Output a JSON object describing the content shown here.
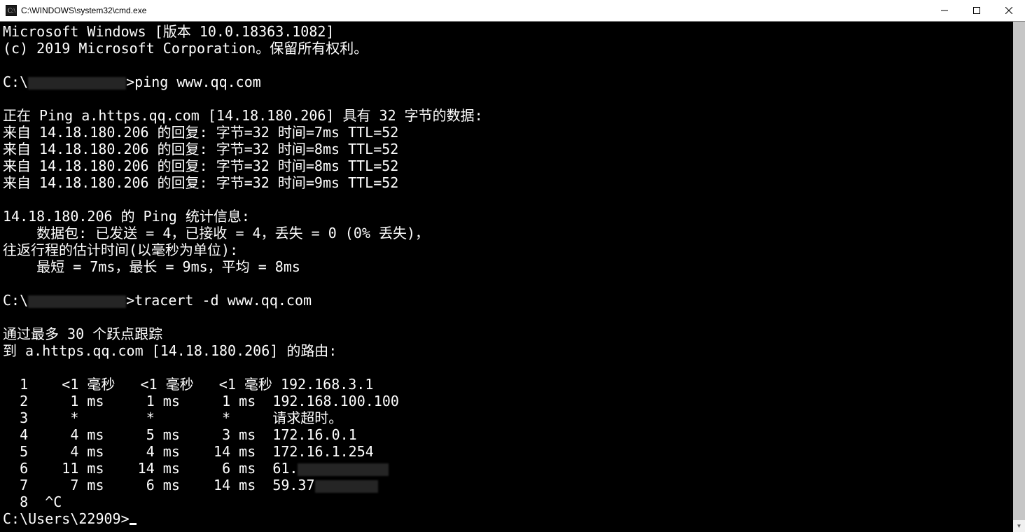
{
  "titlebar": {
    "path": "C:\\WINDOWS\\system32\\cmd.exe"
  },
  "terminal": {
    "header1": "Microsoft Windows [版本 10.0.18363.1082]",
    "header2": "(c) 2019 Microsoft Corporation。保留所有权利。",
    "prompt1a": "C:\\",
    "prompt1b": ">ping www.qq.com",
    "ping_header": "正在 Ping a.https.qq.com [14.18.180.206] 具有 32 字节的数据:",
    "ping_r1": "来自 14.18.180.206 的回复: 字节=32 时间=7ms TTL=52",
    "ping_r2": "来自 14.18.180.206 的回复: 字节=32 时间=8ms TTL=52",
    "ping_r3": "来自 14.18.180.206 的回复: 字节=32 时间=8ms TTL=52",
    "ping_r4": "来自 14.18.180.206 的回复: 字节=32 时间=9ms TTL=52",
    "stats_header": "14.18.180.206 的 Ping 统计信息:",
    "stats_packets": "    数据包: 已发送 = 4，已接收 = 4，丢失 = 0 (0% 丢失)，",
    "stats_rtt_header": "往返行程的估计时间(以毫秒为单位):",
    "stats_rtt_values": "    最短 = 7ms，最长 = 9ms，平均 = 8ms",
    "prompt2a": "C:\\",
    "prompt2b": ">tracert -d www.qq.com",
    "tracert_l1": "通过最多 30 个跃点跟踪",
    "tracert_l2": "到 a.https.qq.com [14.18.180.206] 的路由:",
    "hop1": "  1    <1 毫秒   <1 毫秒   <1 毫秒 192.168.3.1",
    "hop2": "  2     1 ms     1 ms     1 ms  192.168.100.100",
    "hop3": "  3     *        *        *     请求超时。",
    "hop4": "  4     4 ms     5 ms     3 ms  172.16.0.1",
    "hop5": "  5     4 ms     4 ms    14 ms  172.16.1.254",
    "hop6a": "  6    11 ms    14 ms     6 ms  61.",
    "hop7a": "  7     7 ms     6 ms    14 ms  59.37",
    "hop8": "  8  ^C",
    "prompt3": "C:\\Users\\22909>"
  }
}
